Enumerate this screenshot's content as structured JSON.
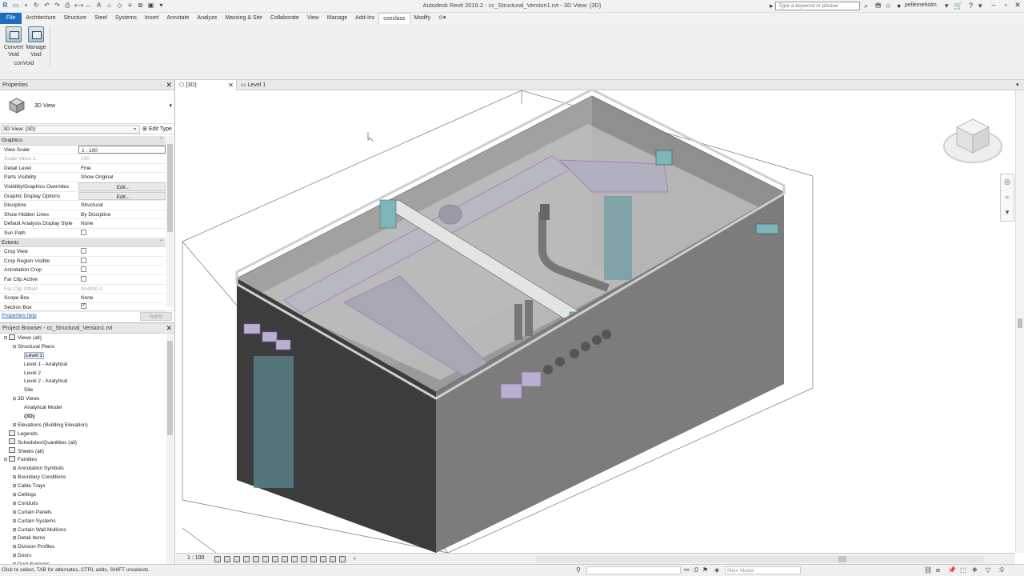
{
  "app": {
    "title": "Autodesk Revit 2019.2 - cc_Structural_Version1.rvt - 3D View: {3D}",
    "search_placeholder": "Type a keyword or phrase",
    "username": "pellemeholm",
    "accent": "#1c6fbb"
  },
  "ribbon": {
    "tabs": [
      "File",
      "Architecture",
      "Structure",
      "Steel",
      "Systems",
      "Insert",
      "Annotate",
      "Analyze",
      "Massing & Site",
      "Collaborate",
      "View",
      "Manage",
      "Add-Ins",
      "conclass",
      "Modify"
    ],
    "active_tab": "conclass",
    "buttons": [
      {
        "line1": "Convert",
        "line2": "Void"
      },
      {
        "line1": "Manage",
        "line2": "Void"
      }
    ],
    "panel_name": "conVoid"
  },
  "properties": {
    "header": "Properties",
    "type_name": "3D View",
    "view_selector": "3D View: {3D}",
    "edit_type": "Edit Type",
    "groups": [
      {
        "name": "Graphics",
        "rows": [
          {
            "key": "View Scale",
            "value": "1 : 100",
            "style": "box"
          },
          {
            "key": "Scale Value    1:",
            "value": "100",
            "style": "dim"
          },
          {
            "key": "Detail Level",
            "value": "Fine"
          },
          {
            "key": "Parts Visibility",
            "value": "Show Original"
          },
          {
            "key": "Visibility/Graphics Overrides",
            "value": "Edit...",
            "style": "btn"
          },
          {
            "key": "Graphic Display Options",
            "value": "Edit...",
            "style": "btn"
          },
          {
            "key": "Discipline",
            "value": "Structural"
          },
          {
            "key": "Show Hidden Lines",
            "value": "By Discipline"
          },
          {
            "key": "Default Analysis Display Style",
            "value": "None"
          },
          {
            "key": "Sun Path",
            "value": "",
            "style": "check"
          }
        ]
      },
      {
        "name": "Extents",
        "rows": [
          {
            "key": "Crop View",
            "value": "",
            "style": "check"
          },
          {
            "key": "Crop Region Visible",
            "value": "",
            "style": "check"
          },
          {
            "key": "Annotation Crop",
            "value": "",
            "style": "check"
          },
          {
            "key": "Far Clip Active",
            "value": "",
            "style": "check"
          },
          {
            "key": "Far Clip Offset",
            "value": "304800.0",
            "style": "dim"
          },
          {
            "key": "Scope Box",
            "value": "None"
          },
          {
            "key": "Section Box",
            "value": "",
            "style": "checked"
          }
        ]
      }
    ],
    "help_link": "Properties help",
    "apply": "Apply"
  },
  "browser": {
    "header": "Project Browser - cc_Structural_Version1.rvt",
    "nodes": [
      {
        "label": "Views (all)",
        "level": 0,
        "toggle": "⊟",
        "icon": true
      },
      {
        "label": "Structural Plans",
        "level": 1,
        "toggle": "⊟"
      },
      {
        "label": "Level 1",
        "level": 2,
        "selected": true
      },
      {
        "label": "Level 1 - Analytical",
        "level": 2
      },
      {
        "label": "Level 2",
        "level": 2
      },
      {
        "label": "Level 2 - Analytical",
        "level": 2
      },
      {
        "label": "Site",
        "level": 2
      },
      {
        "label": "3D Views",
        "level": 1,
        "toggle": "⊟"
      },
      {
        "label": "Analytical Model",
        "level": 2
      },
      {
        "label": "{3D}",
        "level": 2,
        "bold": true
      },
      {
        "label": "Elevations (Building Elevation)",
        "level": 1,
        "toggle": "⊞"
      },
      {
        "label": "Legends",
        "level": 0,
        "icon": true
      },
      {
        "label": "Schedules/Quantities (all)",
        "level": 0,
        "icon": true
      },
      {
        "label": "Sheets (all)",
        "level": 0,
        "icon": true
      },
      {
        "label": "Families",
        "level": 0,
        "toggle": "⊟",
        "icon": true
      },
      {
        "label": "Annotation Symbols",
        "level": 1,
        "toggle": "⊞"
      },
      {
        "label": "Boundary Conditions",
        "level": 1,
        "toggle": "⊞"
      },
      {
        "label": "Cable Trays",
        "level": 1,
        "toggle": "⊞"
      },
      {
        "label": "Ceilings",
        "level": 1,
        "toggle": "⊞"
      },
      {
        "label": "Conduits",
        "level": 1,
        "toggle": "⊞"
      },
      {
        "label": "Curtain Panels",
        "level": 1,
        "toggle": "⊞"
      },
      {
        "label": "Curtain Systems",
        "level": 1,
        "toggle": "⊞"
      },
      {
        "label": "Curtain Wall Mullions",
        "level": 1,
        "toggle": "⊞"
      },
      {
        "label": "Detail Items",
        "level": 1,
        "toggle": "⊞"
      },
      {
        "label": "Division Profiles",
        "level": 1,
        "toggle": "⊞"
      },
      {
        "label": "Doors",
        "level": 1,
        "toggle": "⊞"
      },
      {
        "label": "Duct Systems",
        "level": 1,
        "toggle": "⊞"
      }
    ]
  },
  "view": {
    "tabs": [
      {
        "label": "{3D}",
        "active": true
      },
      {
        "label": "Level 1",
        "active": false
      }
    ],
    "scale": "1 : 100"
  },
  "status": {
    "text": "Click to select, TAB for alternates, CTRL adds, SHIFT unselects.",
    "selection_count": ":0",
    "model": "Main Model"
  }
}
